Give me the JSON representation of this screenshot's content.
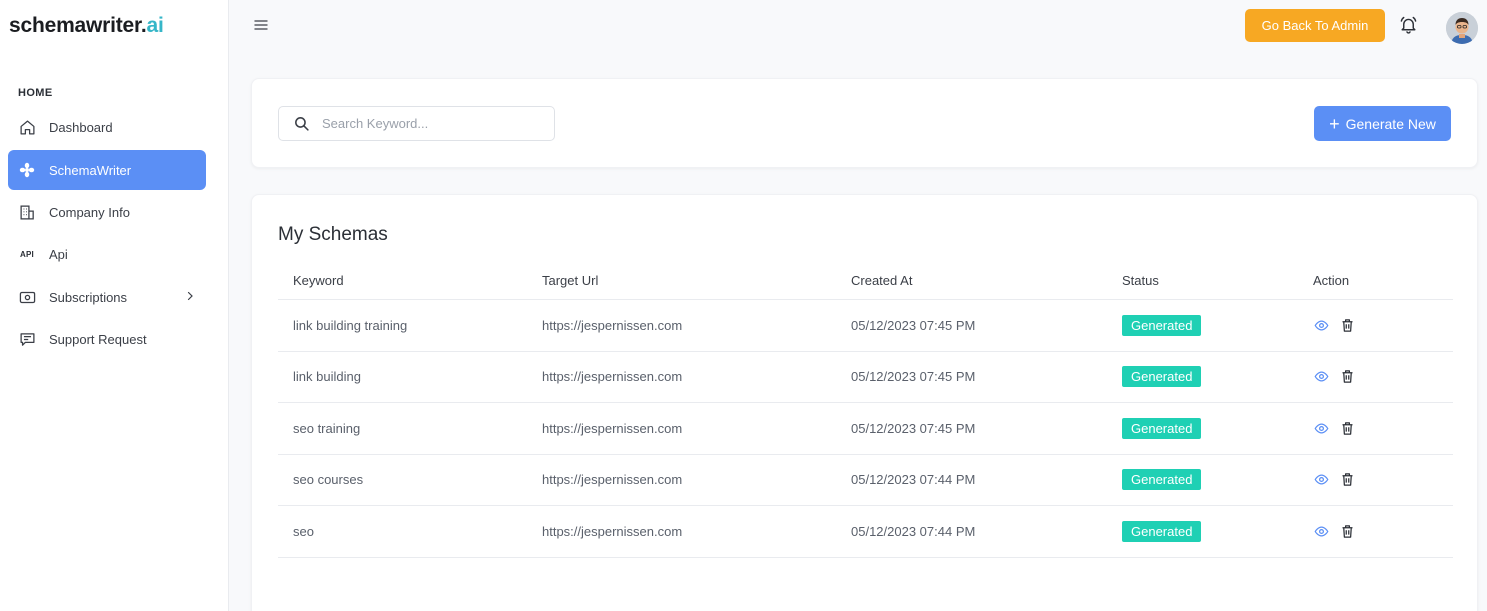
{
  "brand": {
    "name_main": "schemawriter.",
    "name_suffix": "ai",
    "accent": "#36b6c8"
  },
  "sidebar": {
    "section_label": "HOME",
    "items": [
      {
        "label": "Dashboard",
        "icon": "home-icon"
      },
      {
        "label": "SchemaWriter",
        "icon": "flower-icon",
        "active": true
      },
      {
        "label": "Company Info",
        "icon": "building-icon"
      },
      {
        "label": "Api",
        "icon": "api-icon",
        "icon_text": "API"
      },
      {
        "label": "Subscriptions",
        "icon": "money-icon",
        "has_submenu": true
      },
      {
        "label": "Support Request",
        "icon": "message-icon"
      }
    ]
  },
  "topbar": {
    "admin_button": "Go Back To Admin"
  },
  "search": {
    "placeholder": "Search Keyword...",
    "value": ""
  },
  "generate_button": "Generate New",
  "table": {
    "title": "My Schemas",
    "headers": [
      "Keyword",
      "Target Url",
      "Created At",
      "Status",
      "Action"
    ],
    "rows": [
      {
        "keyword": "link building training",
        "url": "https://jespernissen.com",
        "created": "05/12/2023 07:45 PM",
        "status": "Generated"
      },
      {
        "keyword": "link building",
        "url": "https://jespernissen.com",
        "created": "05/12/2023 07:45 PM",
        "status": "Generated"
      },
      {
        "keyword": "seo training",
        "url": "https://jespernissen.com",
        "created": "05/12/2023 07:45 PM",
        "status": "Generated"
      },
      {
        "keyword": "seo courses",
        "url": "https://jespernissen.com",
        "created": "05/12/2023 07:44 PM",
        "status": "Generated"
      },
      {
        "keyword": "seo",
        "url": "https://jespernissen.com",
        "created": "05/12/2023 07:44 PM",
        "status": "Generated"
      }
    ]
  },
  "colors": {
    "primary": "#5b8ff5",
    "warning": "#f7a823",
    "success": "#1fd0b4"
  }
}
